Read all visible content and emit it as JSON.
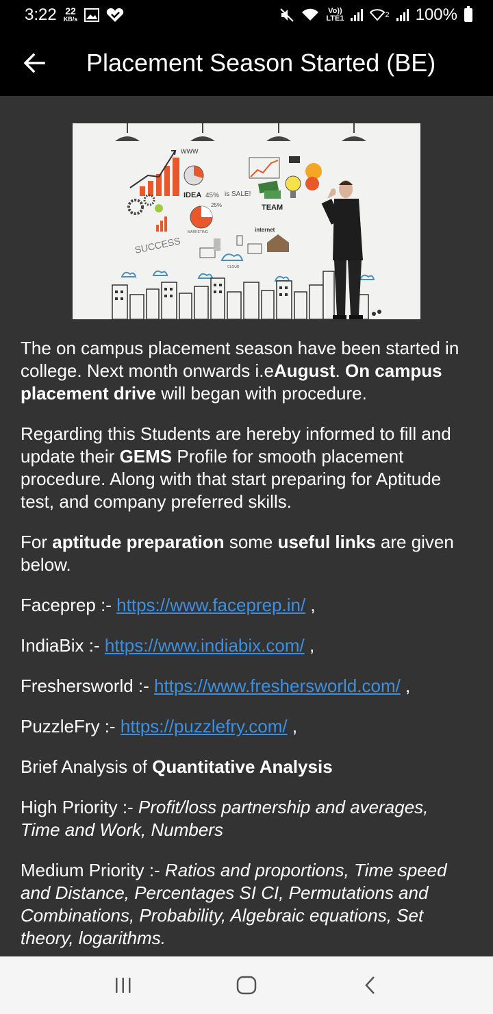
{
  "status": {
    "time": "3:22",
    "kb_value": "22",
    "kb_unit": "KB/s",
    "net_label_top": "Vo))",
    "net_label_bottom": "LTE1",
    "sim2_label": "2",
    "battery": "100%"
  },
  "appbar": {
    "title": "Placement Season Started (BE)",
    "back_icon": "arrow-left-icon"
  },
  "hero_image": {
    "words": [
      "WWW",
      "iDEA",
      "45%",
      "is SALE!",
      "TEAM",
      "25%",
      "MARKETING",
      "SUCCESS",
      "internet",
      "CLOUD"
    ]
  },
  "body": {
    "p1": {
      "t1": "The on campus placement season have been started in college. Next month onwards i.e",
      "b1": "August",
      "t2": ". ",
      "b2": "On campus placement drive",
      "t3": " will began with procedure."
    },
    "p2": {
      "t1": "Regarding this Students are hereby informed to fill and update their ",
      "b1": "GEMS",
      "t2": " Profile for smooth placement procedure. Along with that start preparing for Aptitude test, and company preferred skills."
    },
    "p3": {
      "t1": "For ",
      "b1": "aptitude preparation",
      "t2": " some ",
      "b2": "useful links",
      "t3": " are given below."
    },
    "links": [
      {
        "name": "Faceprep :- ",
        "url": "https://www.faceprep.in/",
        "suffix": " ,"
      },
      {
        "name": "IndiaBix :- ",
        "url": "https://www.indiabix.com/",
        "suffix": " ,"
      },
      {
        "name": "Freshersworld :- ",
        "url": "https://www.freshersworld.com/",
        "suffix": " ,"
      },
      {
        "name": "PuzzleFry :- ",
        "url": "https://puzzlefry.com/",
        "suffix": " ,"
      }
    ],
    "p4": {
      "t1": "Brief Analysis of ",
      "b1": "Quantitative Analysis"
    },
    "p5": {
      "label": "High Priority :- ",
      "items": "Profit/loss partnership and averages, Time and Work, Numbers"
    },
    "p6": {
      "label": "Medium Priority :- ",
      "items": "Ratios and proportions, Time speed and Distance, Percentages SI CI, Permutations and Combinations, Probability, Algebraic equations, Set theory, logarithms."
    }
  },
  "navbar": {
    "recents_icon": "recent-apps-icon",
    "home_icon": "home-icon",
    "back_icon": "back-icon"
  },
  "colors": {
    "background": "#333333",
    "appbar": "#000000",
    "link": "#3d8fe0",
    "navbar": "#f5f5f5"
  }
}
